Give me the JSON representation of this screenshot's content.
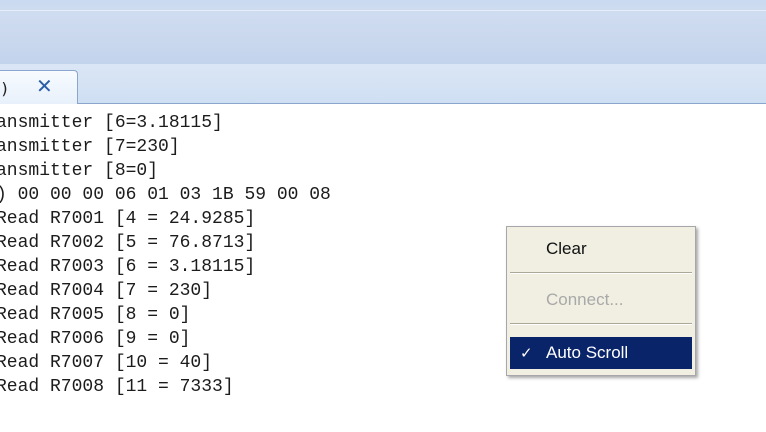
{
  "tab": {
    "label": ")",
    "close_glyph": "✕"
  },
  "console": {
    "lines": [
      "ansmitter [6=3.18115]",
      "ansmitter [7=230]",
      "ansmitter [8=0]",
      ") 00 00 00 06 01 03 1B 59 00 08",
      "Read R7001 [4 = 24.9285]",
      "Read R7002 [5 = 76.8713]",
      "Read R7003 [6 = 3.18115]",
      "Read R7004 [7 = 230]",
      "Read R7005 [8 = 0]",
      "Read R7006 [9 = 0]",
      "Read R7007 [10 = 40]",
      "Read R7008 [11 = 7333]"
    ]
  },
  "context_menu": {
    "clear": "Clear",
    "connect": "Connect...",
    "auto_scroll": "Auto Scroll",
    "auto_scroll_check": "✓"
  },
  "colors": {
    "header_band": "#c9d9ef",
    "menu_background": "#f1efe2",
    "menu_highlight": "#0a246a",
    "tab_close": "#2a5ea8"
  },
  "icons": {
    "tab_close": "close-icon",
    "auto_scroll_check": "checkmark-icon"
  }
}
